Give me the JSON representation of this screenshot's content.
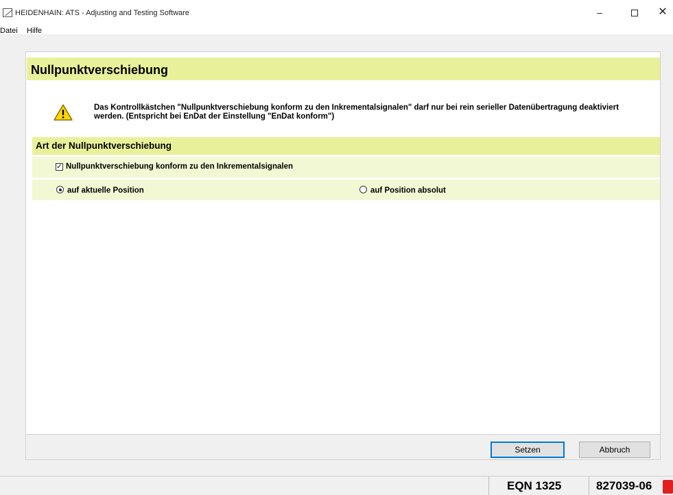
{
  "window": {
    "title": "HEIDENHAIN: ATS - Adjusting and Testing Software",
    "minimize": "–",
    "close": "✕"
  },
  "menu": {
    "items": [
      "Datei",
      "Hilfe"
    ]
  },
  "page": {
    "title": "Nullpunktverschiebung",
    "warning_text": "Das Kontrollkästchen \"Nullpunktverschiebung konform zu den Inkrementalsignalen\" darf nur bei rein serieller Datenübertragung deaktiviert werden. (Entspricht bei EnDat der Einstellung \"EnDat konform\")",
    "section_title": "Art der Nullpunktverschiebung",
    "checkbox": {
      "label": "Nullpunktverschiebung konform zu den Inkrementalsignalen",
      "checked": true
    },
    "radios": [
      {
        "label": "auf aktuelle Position",
        "selected": true
      },
      {
        "label": "auf Position absolut",
        "selected": false
      }
    ]
  },
  "buttons": {
    "setzen": "Setzen",
    "abbruch": "Abbruch"
  },
  "status": {
    "model": "EQN 1325",
    "id": "827039-06"
  },
  "colors": {
    "header_bg": "#e8f19a",
    "row_bg": "#f2f8d4",
    "plug_icon": "#e02020"
  }
}
